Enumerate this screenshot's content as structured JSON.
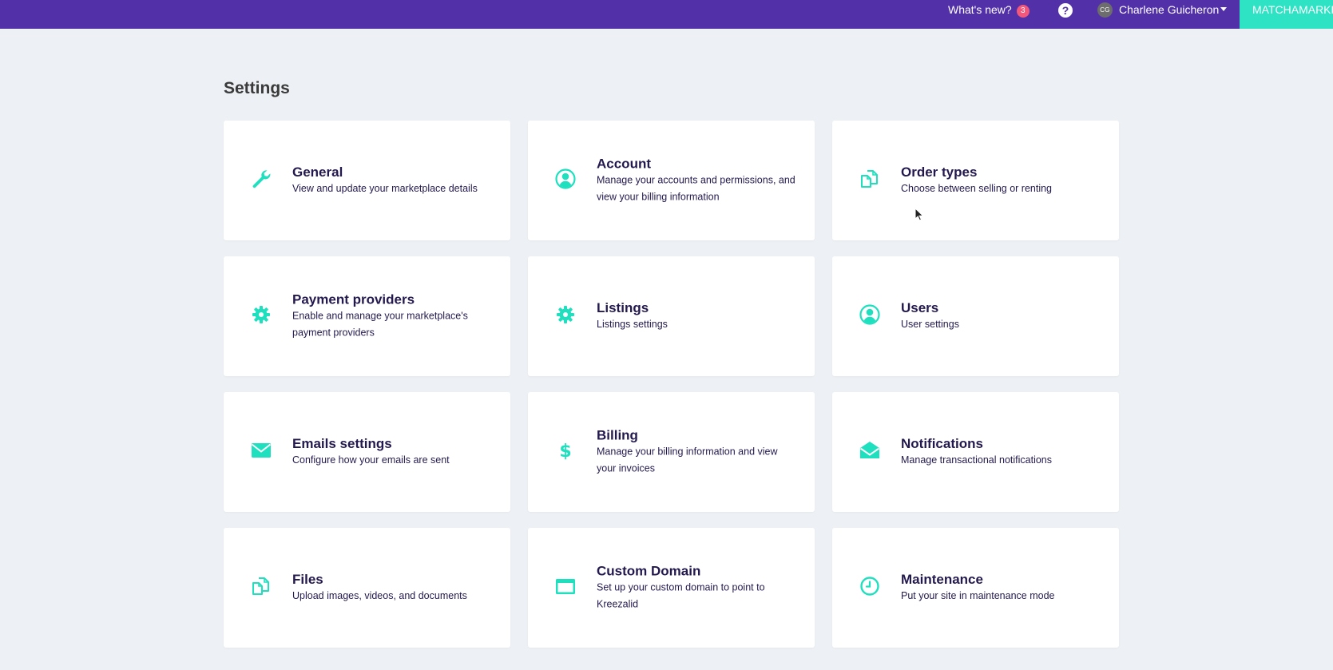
{
  "topbar": {
    "whats_new_label": "What's new?",
    "whats_new_count": "3",
    "help_icon": "question-circle-icon",
    "avatar_initials": "CG",
    "user_name": "Charlene Guicheron",
    "brand_label": "MATCHAMARKET",
    "colors": {
      "bar": "#5230a8",
      "brand": "#2ee3c4",
      "badge": "#f2577c"
    }
  },
  "page": {
    "title": "Settings"
  },
  "accent_color": "#1ee0be",
  "cards": [
    {
      "title": "General",
      "desc": "View and update your marketplace details",
      "icon": "wrench-icon"
    },
    {
      "title": "Account",
      "desc": "Manage your accounts and permissions, and view your billing information",
      "icon": "user-circle-icon"
    },
    {
      "title": "Order types",
      "desc": "Choose between selling or renting",
      "icon": "documents-icon"
    },
    {
      "title": "Payment providers",
      "desc": "Enable and manage your marketplace's payment providers",
      "icon": "gear-icon"
    },
    {
      "title": "Listings",
      "desc": "Listings settings",
      "icon": "gear-icon"
    },
    {
      "title": "Users",
      "desc": "User settings",
      "icon": "user-circle-icon"
    },
    {
      "title": "Emails settings",
      "desc": "Configure how your emails are sent",
      "icon": "envelope-icon"
    },
    {
      "title": "Billing",
      "desc": "Manage your billing information and view your invoices",
      "icon": "dollar-icon"
    },
    {
      "title": "Notifications",
      "desc": "Manage transactional notifications",
      "icon": "envelope-open-icon"
    },
    {
      "title": "Files",
      "desc": "Upload images, videos, and documents",
      "icon": "documents-icon"
    },
    {
      "title": "Custom Domain",
      "desc": "Set up your custom domain to point to Kreezalid",
      "icon": "browser-window-icon"
    },
    {
      "title": "Maintenance",
      "desc": "Put your site in maintenance mode",
      "icon": "clock-icon"
    }
  ]
}
